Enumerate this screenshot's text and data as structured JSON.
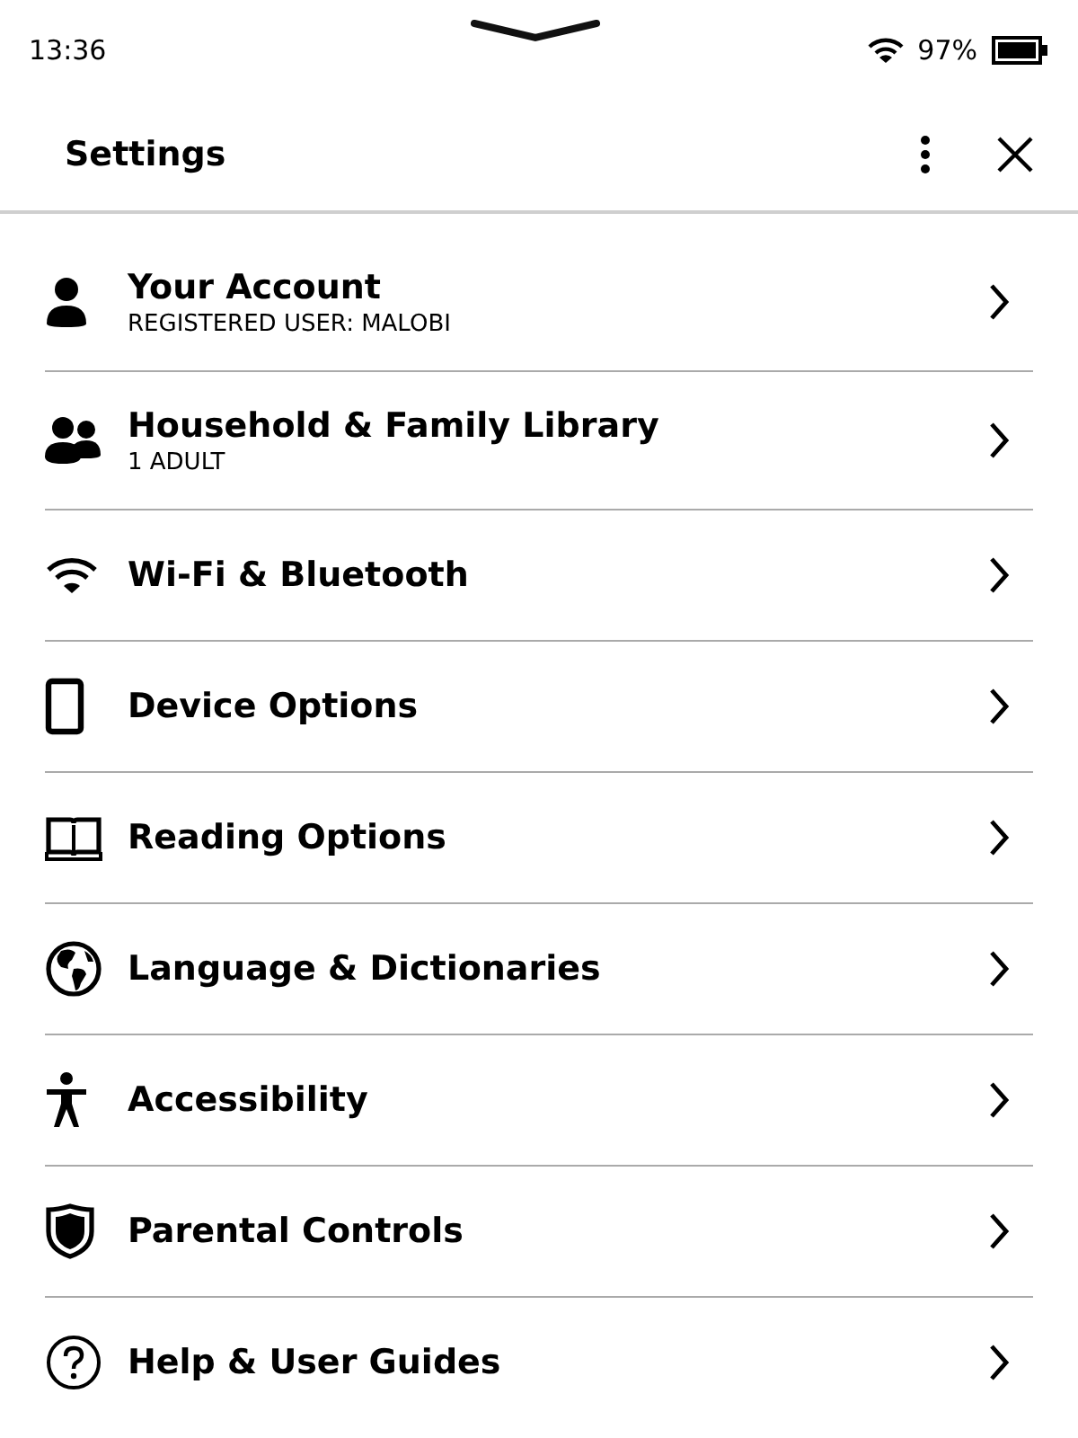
{
  "status_bar": {
    "time": "13:36",
    "battery": "97%"
  },
  "header": {
    "title": "Settings"
  },
  "items": [
    {
      "title": "Your Account",
      "subtitle": "REGISTERED USER: MALOBI"
    },
    {
      "title": "Household & Family Library",
      "subtitle": "1 ADULT"
    },
    {
      "title": "Wi-Fi & Bluetooth"
    },
    {
      "title": "Device Options"
    },
    {
      "title": "Reading Options"
    },
    {
      "title": "Language & Dictionaries"
    },
    {
      "title": "Accessibility"
    },
    {
      "title": "Parental Controls"
    },
    {
      "title": "Help & User Guides"
    }
  ]
}
